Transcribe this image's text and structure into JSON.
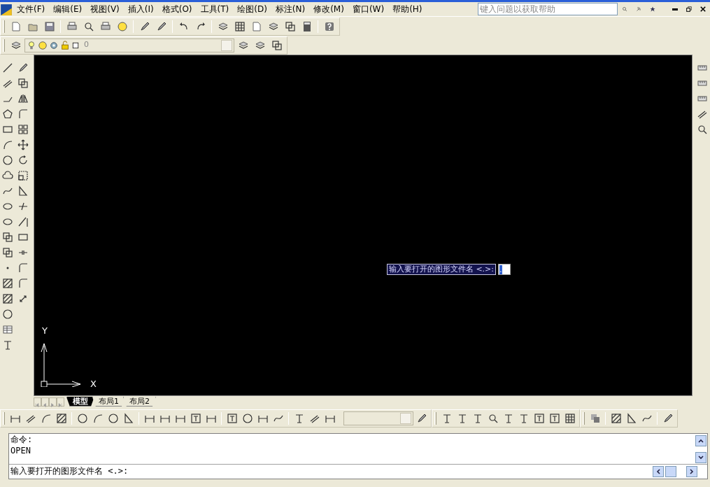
{
  "menu": [
    {
      "label": "文件(F)"
    },
    {
      "label": "编辑(E)"
    },
    {
      "label": "视图(V)"
    },
    {
      "label": "插入(I)"
    },
    {
      "label": "格式(O)"
    },
    {
      "label": "工具(T)"
    },
    {
      "label": "绘图(D)"
    },
    {
      "label": "标注(N)"
    },
    {
      "label": "修改(M)"
    },
    {
      "label": "窗口(W)"
    },
    {
      "label": "帮助(H)"
    }
  ],
  "help_search": {
    "placeholder": "键入问题以获取帮助"
  },
  "layer_control": {
    "value": "0"
  },
  "canvas": {
    "ucs": {
      "y_label": "Y",
      "x_label": "X"
    },
    "dynamic_prompt": {
      "text": "输入要打开的图形文件名 <.>:",
      "value": "."
    }
  },
  "layout_tabs": [
    {
      "label": "模型",
      "selected": true
    },
    {
      "label": "布局1",
      "selected": false
    },
    {
      "label": "布局2",
      "selected": false
    }
  ],
  "command_history": [
    "命令:",
    "OPEN"
  ],
  "command_line": {
    "text": "输入要打开的图形文件名 <.>:"
  }
}
